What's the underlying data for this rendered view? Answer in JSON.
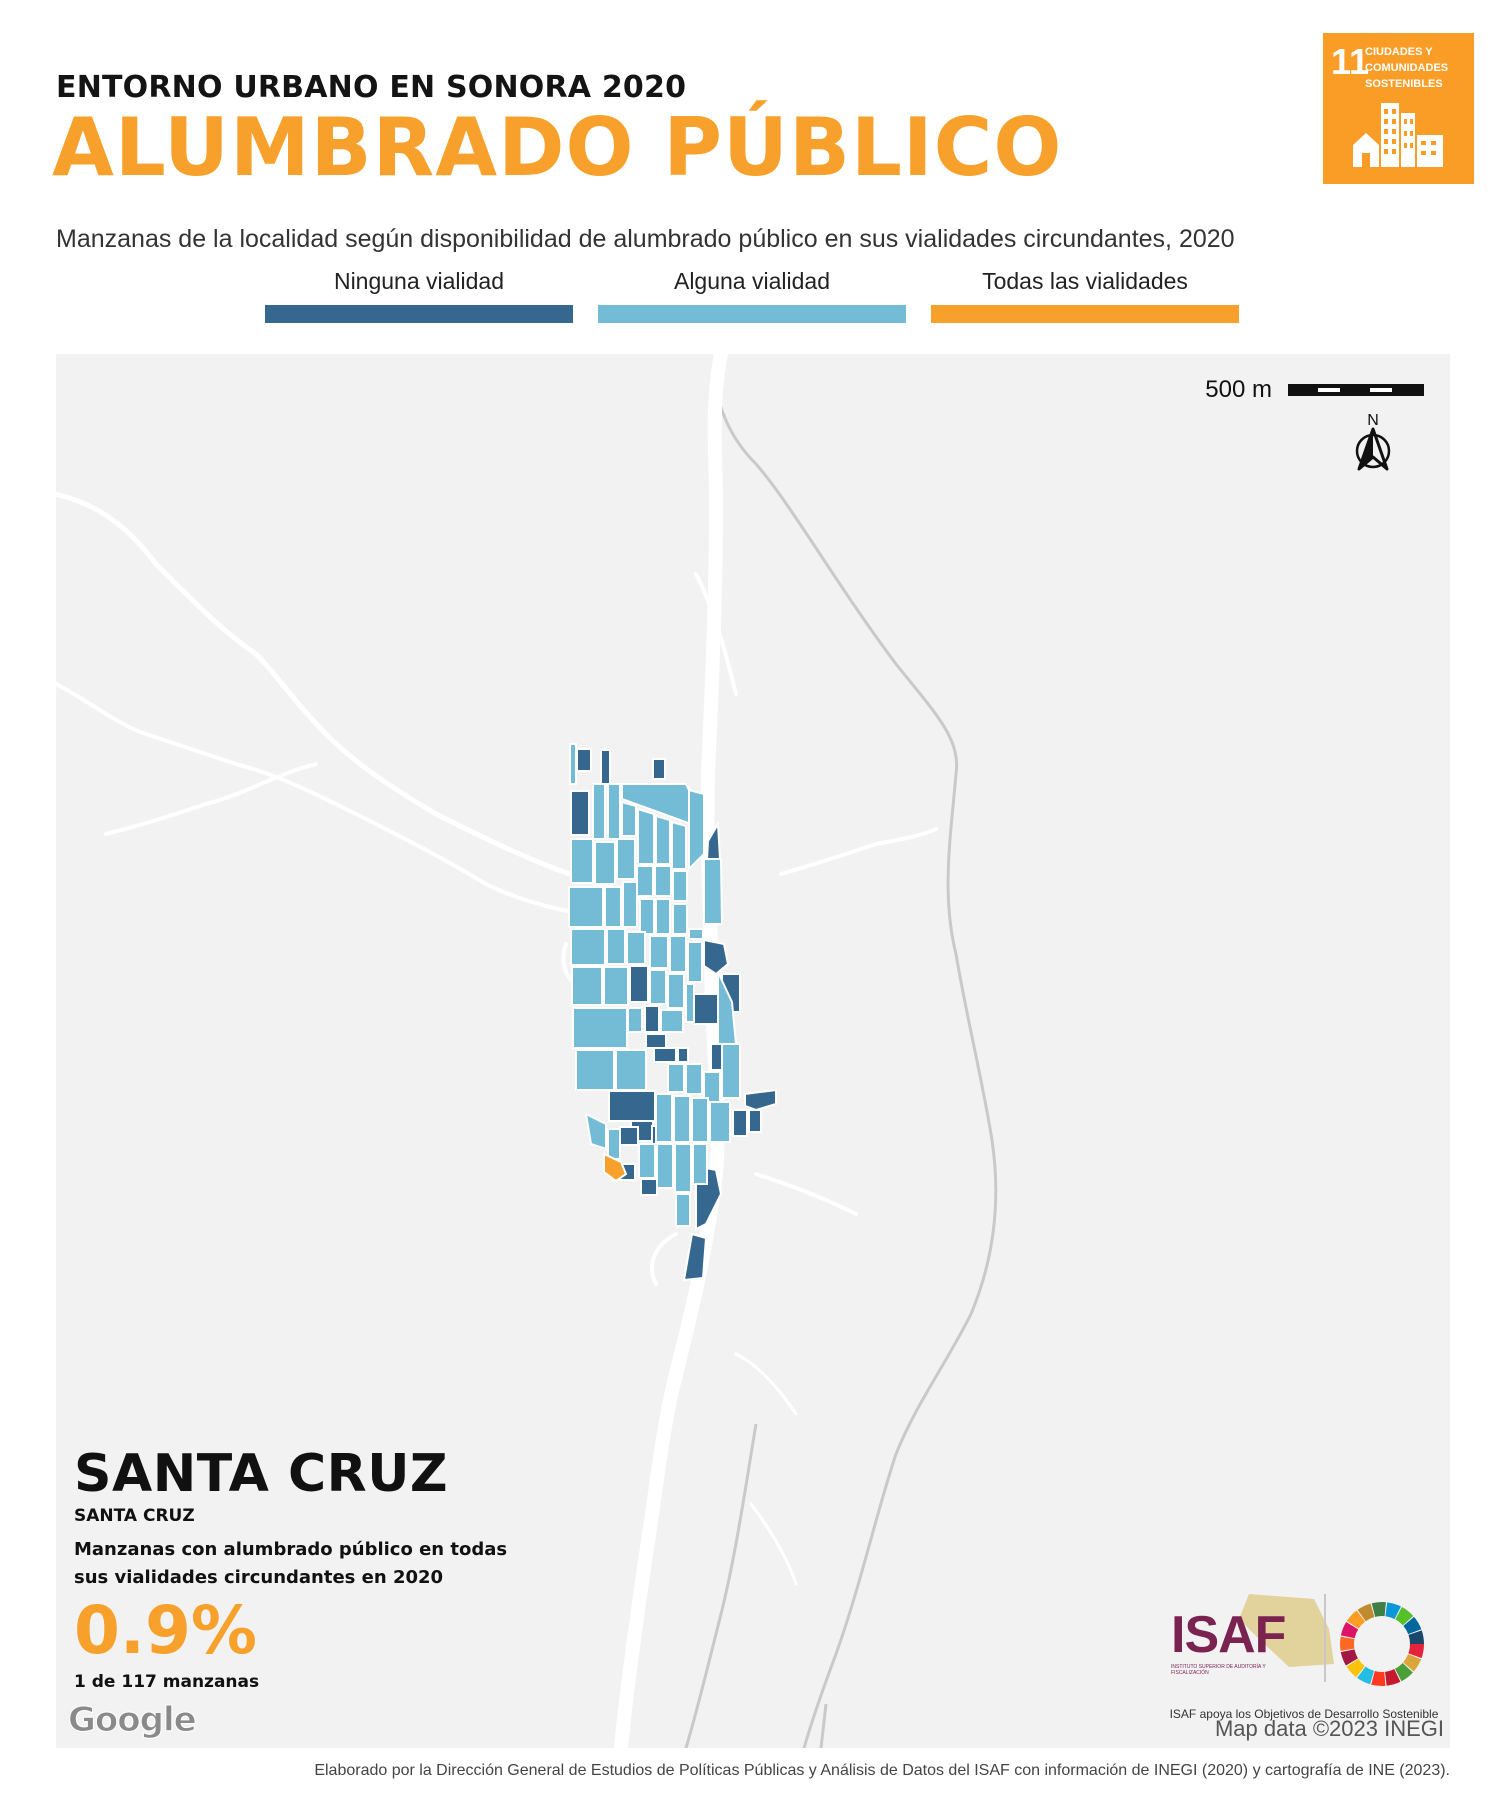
{
  "header": {
    "supertitle": "ENTORNO URBANO EN SONORA 2020",
    "title": "ALUMBRADO PÚBLICO",
    "subtitle": "Manzanas de la localidad según disponibilidad de alumbrado público en sus vialidades circundantes, 2020"
  },
  "sdg_badge": {
    "number": "11",
    "label": "CIUDADES Y COMUNIDADES SOSTENIBLES",
    "color": "#f99d26",
    "icon": "city-buildings-icon"
  },
  "legend": [
    {
      "label": "Ninguna vialidad",
      "color": "#35678f"
    },
    {
      "label": "Alguna vialidad",
      "color": "#74bcd6"
    },
    {
      "label": "Todas las vialidades",
      "color": "#f7a12c"
    }
  ],
  "map": {
    "scale_label": "500 m",
    "north_label": "N",
    "attribution": "Map data ©2023 INEGI",
    "provider_logo": "Google",
    "background_color": "#f2f2f2",
    "road_color": "#ffffff"
  },
  "summary": {
    "municipality": "SANTA CRUZ",
    "locality": "SANTA CRUZ",
    "description": "Manzanas con alumbrado público en todas sus vialidades circundantes en 2020",
    "percentage": "0.9%",
    "count": "1 de 117 manzanas"
  },
  "isaf": {
    "name": "ISAF",
    "subname": "INSTITUTO SUPERIOR DE AUDITORÍA Y FISCALIZACIÓN",
    "caption": "ISAF apoya los Objetivos de Desarrollo Sostenible",
    "color": "#7b2350"
  },
  "footer": {
    "credit": "Elaborado por la Dirección General de Estudios de Políticas Públicas y Análisis de Datos del ISAF con información de INEGI (2020) y cartografía de INE (2023)."
  }
}
